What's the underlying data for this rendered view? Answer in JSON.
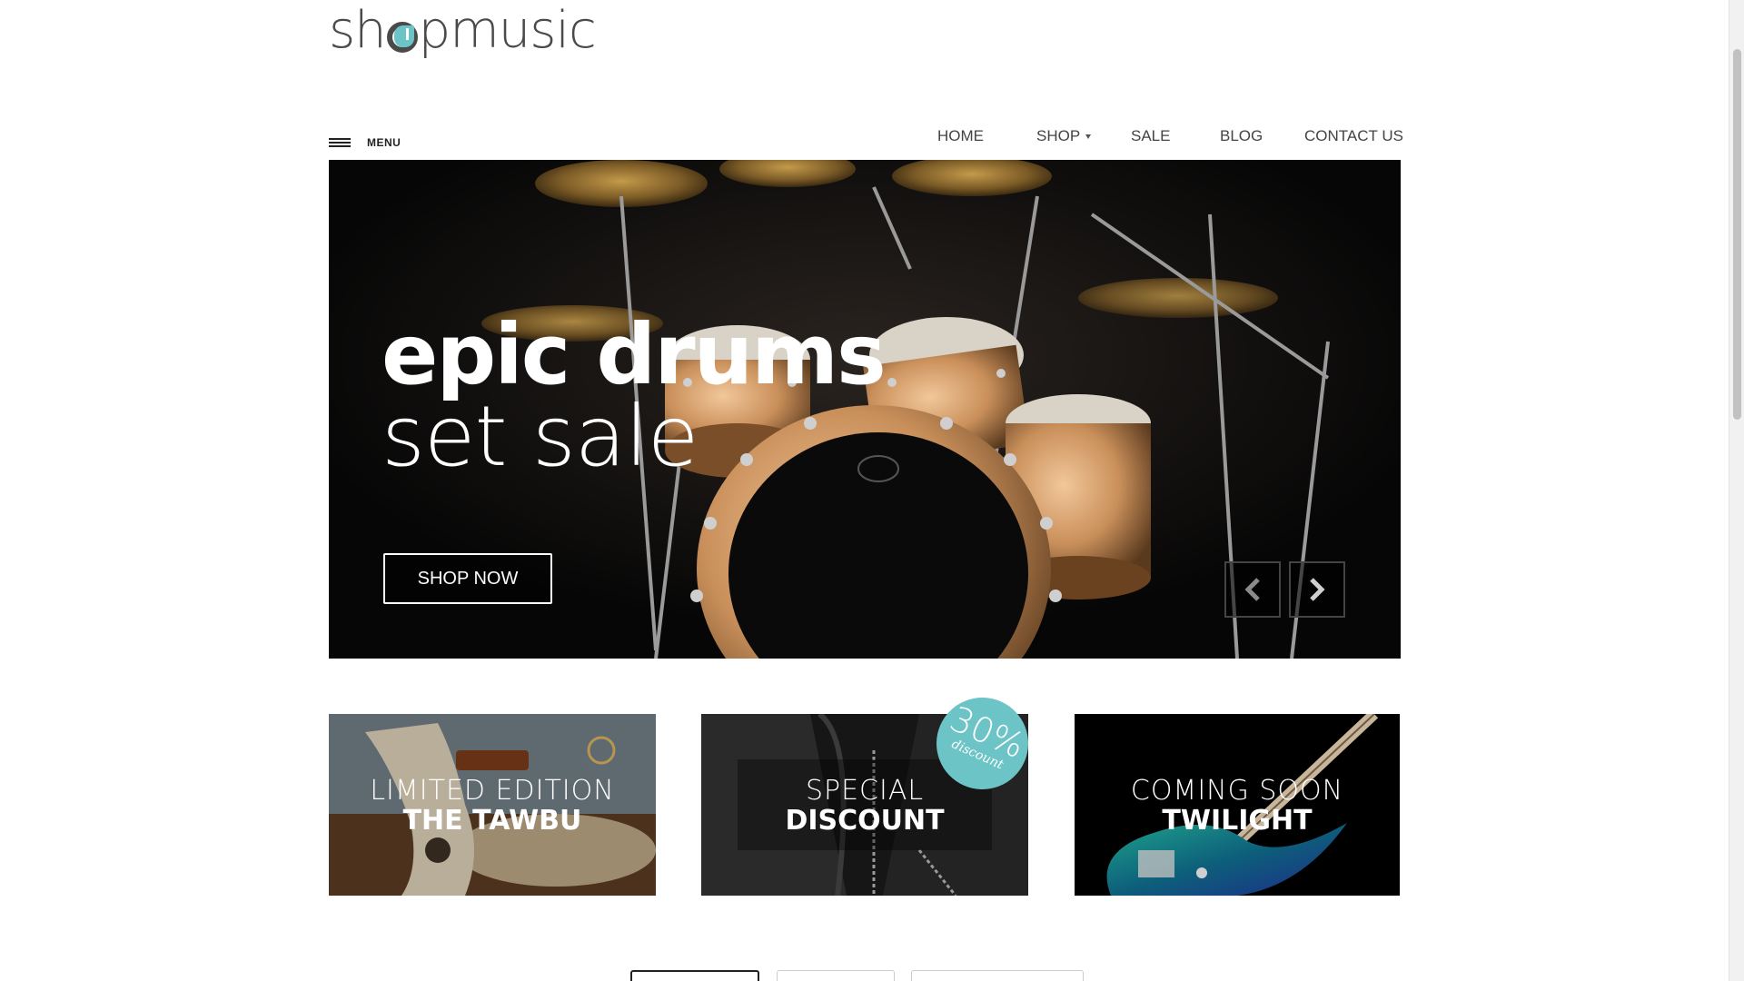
{
  "logo": {
    "pre": "sh",
    "post": "pmusic"
  },
  "menu": {
    "label": "MENU"
  },
  "nav": [
    {
      "label": "HOME"
    },
    {
      "label": "SHOP"
    },
    {
      "label": "SALE"
    },
    {
      "label": "BLOG"
    },
    {
      "label": "CONTACT US"
    }
  ],
  "hero": {
    "title_line1": "epic drums",
    "title_line2": "set sale",
    "cta_label": "SHOP NOW",
    "prev_icon": "chevron-left-icon",
    "next_icon": "chevron-right-icon"
  },
  "promos": [
    {
      "line1": "LIMITED EDITION",
      "line2": "THE TAWBU"
    },
    {
      "line1": "SPECIAL",
      "line2": "DISCOUNT"
    },
    {
      "line1": "COMING SOON",
      "line2": "TWILIGHT"
    }
  ],
  "badge": {
    "value": "30%",
    "label": "discount"
  },
  "colors": {
    "accent": "#6cc4c6",
    "text": "#444444",
    "hero_bg": "#060606"
  }
}
